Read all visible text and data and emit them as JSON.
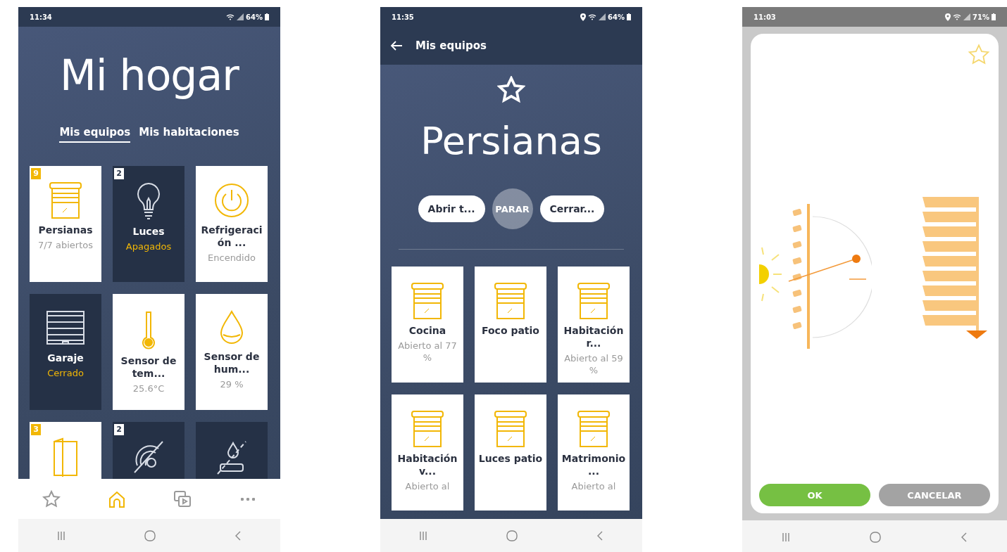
{
  "phones": [
    {
      "kind": "home",
      "status": {
        "time": "11:34",
        "battery": "64%",
        "location": false
      },
      "title": "Mi hogar",
      "tabs": [
        {
          "label": "Mis equipos",
          "selected": true
        },
        {
          "label": "Mis habitaciones",
          "selected": false
        }
      ],
      "tiles": [
        {
          "kind": "blind",
          "on": true,
          "badge": "9",
          "name": "Persianas",
          "status": "7/7 abiertos"
        },
        {
          "kind": "bulb",
          "on": false,
          "badge": "2",
          "name": "Luces",
          "status": "Apagados"
        },
        {
          "kind": "power",
          "on": true,
          "name": "Refrigeración ...",
          "status": "Encendido"
        },
        {
          "kind": "garage",
          "on": false,
          "name": "Garaje",
          "status": "Cerrado"
        },
        {
          "kind": "thermometer",
          "on": true,
          "name": "Sensor de tem...",
          "status": "25.6°C"
        },
        {
          "kind": "drop",
          "on": true,
          "name": "Sensor de hum...",
          "status": "29 %"
        },
        {
          "kind": "door",
          "on": true,
          "badge": "3"
        },
        {
          "kind": "wifi-off",
          "on": false,
          "badge": "2"
        },
        {
          "kind": "leak",
          "on": false
        }
      ],
      "nav": [
        {
          "kind": "star",
          "selected": false
        },
        {
          "kind": "home",
          "selected": true
        },
        {
          "kind": "devices",
          "selected": false
        },
        {
          "kind": "more",
          "selected": false
        }
      ]
    },
    {
      "kind": "list",
      "status": {
        "time": "11:35",
        "battery": "64%",
        "location": true
      },
      "header": "Mis equipos",
      "favorite": false,
      "title": "Persianas",
      "actions": [
        {
          "kind": "pill",
          "label": "Abrir t..."
        },
        {
          "kind": "round",
          "label": "PARAR"
        },
        {
          "kind": "pill",
          "label": "Cerrar..."
        }
      ],
      "tiles": [
        {
          "kind": "blind",
          "on": true,
          "name": "Cocina",
          "status": "Abierto al 77 %"
        },
        {
          "kind": "blind",
          "on": true,
          "name": "Foco patio"
        },
        {
          "kind": "blind",
          "on": true,
          "name": "Habitación r...",
          "status": "Abierto al 59 %"
        },
        {
          "kind": "blind",
          "on": true,
          "name": "Habitación v...",
          "status": "Abierto al"
        },
        {
          "kind": "blind",
          "on": true,
          "name": "Luces patio"
        },
        {
          "kind": "blind",
          "on": true,
          "name": "Matrimonio ...",
          "status": "Abierto al"
        }
      ]
    },
    {
      "kind": "dialog",
      "status": {
        "time": "11:03",
        "battery": "71%",
        "location": true
      },
      "favorite": false,
      "buttons": [
        {
          "kind": "confirm",
          "label": "OK"
        },
        {
          "kind": "cancel",
          "label": "CANCELAR"
        }
      ]
    }
  ]
}
